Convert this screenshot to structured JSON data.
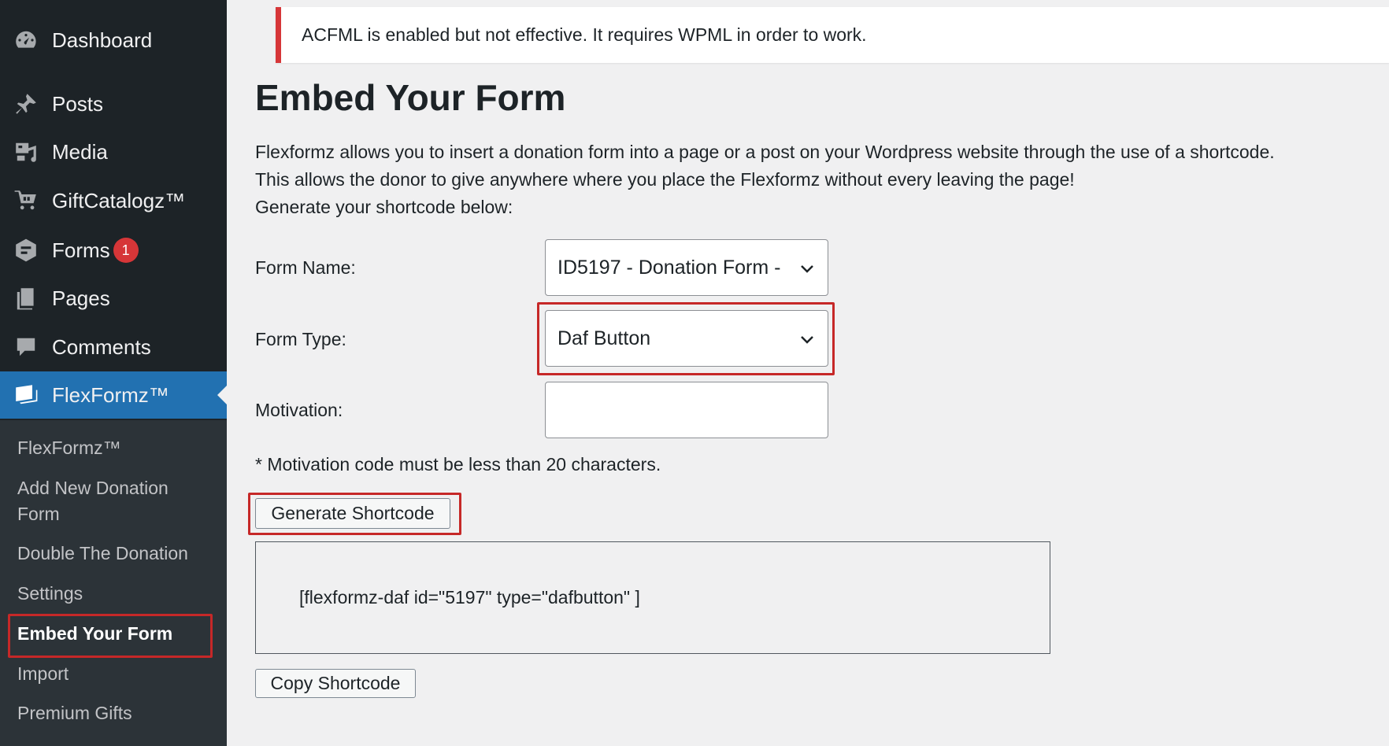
{
  "sidebar": {
    "menu": [
      {
        "label": "Dashboard",
        "icon": "dashboard-icon"
      },
      {
        "label": "Posts",
        "icon": "pin-icon"
      },
      {
        "label": "Media",
        "icon": "media-icon"
      },
      {
        "label": "GiftCatalogz™",
        "icon": "cart-icon"
      },
      {
        "label": "Forms",
        "icon": "forms-icon",
        "badge": "1"
      },
      {
        "label": "Pages",
        "icon": "pages-icon"
      },
      {
        "label": "Comments",
        "icon": "comment-icon"
      },
      {
        "label": "FlexFormz™",
        "icon": "flexformz-icon",
        "active": true
      }
    ],
    "submenu": [
      {
        "label": "FlexFormz™"
      },
      {
        "label": "Add New Donation Form"
      },
      {
        "label": "Double The Donation"
      },
      {
        "label": "Settings"
      },
      {
        "label": "Embed Your Form",
        "current": true
      },
      {
        "label": "Import"
      },
      {
        "label": "Premium Gifts"
      }
    ]
  },
  "notice": {
    "text": "ACFML is enabled but not effective. It requires WPML in order to work.",
    "color": "#d63638"
  },
  "main": {
    "title": "Embed Your Form",
    "intro_line1": "Flexformz allows you to insert a donation form into a page or a post on your Wordpress website through the use of a shortcode.",
    "intro_line2": "This allows the donor to give anywhere where you place the Flexformz without every leaving the page!",
    "intro_line3": "Generate your shortcode below:",
    "form_name_label": "Form Name:",
    "form_name_value": "ID5197 - Donation Form -",
    "form_type_label": "Form Type:",
    "form_type_value": "Daf Button",
    "motivation_label": "Motivation:",
    "motivation_value": "",
    "note": "* Motivation code must be less than 20 characters.",
    "generate_button": "Generate Shortcode",
    "shortcode": "[flexformz-daf id=\"5197\" type=\"dafbutton\" ]",
    "copy_button": "Copy Shortcode"
  },
  "colors": {
    "sidebar_bg": "#1d2327",
    "submenu_bg": "#2c3338",
    "active_bg": "#2271b1",
    "highlight": "#c62828"
  }
}
